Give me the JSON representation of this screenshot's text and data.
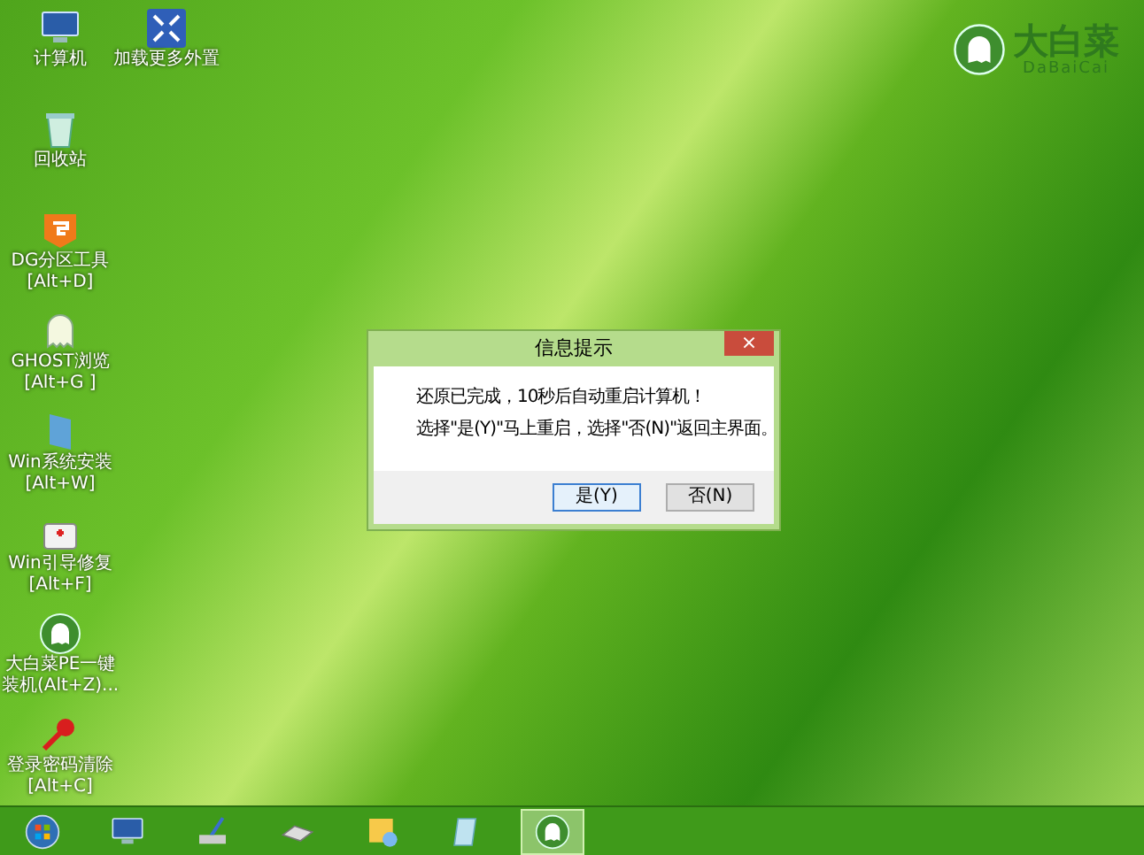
{
  "logo": {
    "title": "大白菜",
    "subtitle": "DaBaiCai"
  },
  "desktop_icons": [
    {
      "kind": "computer",
      "lines": [
        "计算机"
      ]
    },
    {
      "kind": "expand",
      "lines": [
        "加载更多外置"
      ]
    },
    {
      "kind": "recycle",
      "lines": [
        "回收站"
      ]
    },
    {
      "kind": "partition",
      "lines": [
        "DG分区工具",
        "[Alt+D]"
      ]
    },
    {
      "kind": "ghost",
      "lines": [
        "GHOST浏览",
        "[Alt+G ]"
      ]
    },
    {
      "kind": "installer",
      "lines": [
        "Win系统安装",
        "[Alt+W]"
      ]
    },
    {
      "kind": "repair",
      "lines": [
        "Win引导修复",
        "[Alt+F]"
      ]
    },
    {
      "kind": "cabbage",
      "lines": [
        "大白菜PE一键",
        "装机(Alt+Z)..."
      ]
    },
    {
      "kind": "password",
      "lines": [
        "登录密码清除",
        "[Alt+C]"
      ]
    }
  ],
  "dialog": {
    "title": "信息提示",
    "close": "×",
    "message": [
      "还原已完成，10秒后自动重启计算机！",
      "选择\"是(Y)\"马上重启，选择\"否(N)\"返回主界面。"
    ],
    "buttons": [
      {
        "label": "是(Y)",
        "selected": true
      },
      {
        "label": "否(N)",
        "selected": false
      }
    ]
  },
  "taskbar": {
    "items": [
      {
        "kind": "start",
        "selected": false
      },
      {
        "kind": "monitor",
        "selected": false
      },
      {
        "kind": "brush",
        "selected": false
      },
      {
        "kind": "drive",
        "selected": false
      },
      {
        "kind": "paint",
        "selected": false
      },
      {
        "kind": "notepad",
        "selected": false
      },
      {
        "kind": "cabbage",
        "selected": true
      }
    ]
  }
}
